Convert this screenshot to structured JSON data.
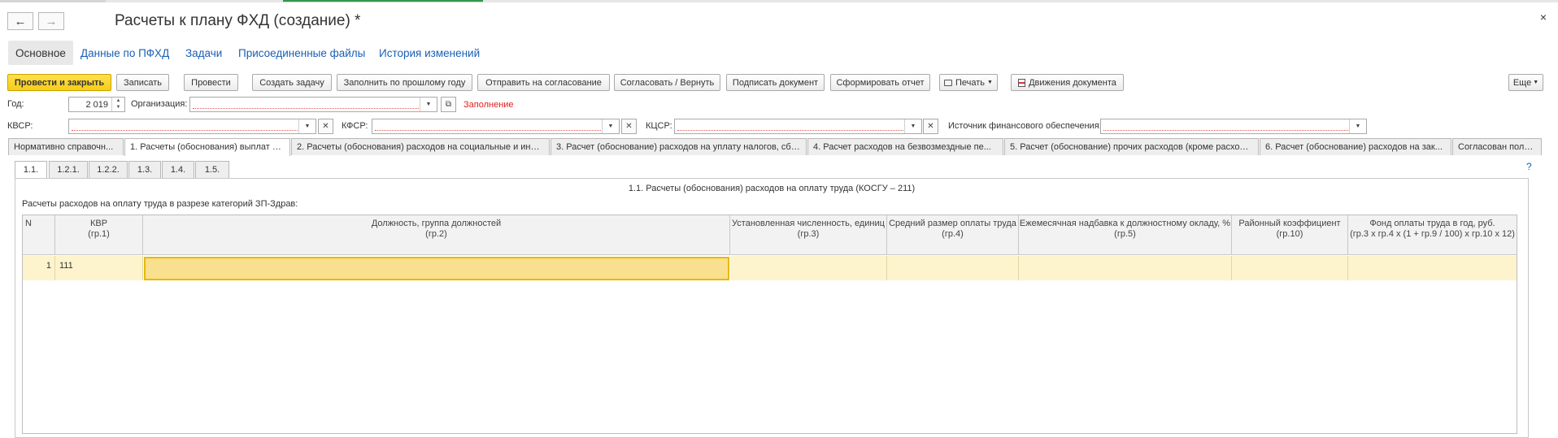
{
  "window": {
    "title": "Расчеты к плану ФХД (создание) *",
    "back_icon": "←",
    "forward_icon": "→",
    "close_icon": "×"
  },
  "nav_tabs": [
    "Основное",
    "Данные по ПФХД",
    "Задачи",
    "Присоединенные файлы",
    "История изменений"
  ],
  "toolbar": {
    "post_close": "Провести и закрыть",
    "save": "Записать",
    "post": "Провести",
    "create_task": "Создать задачу",
    "fill_last_year": "Заполнить по прошлому году",
    "send_approval": "Отправить на согласование",
    "approve_return": "Согласовать / Вернуть",
    "sign": "Подписать документ",
    "report": "Сформировать отчет",
    "print": "Печать",
    "movements": "Движения документа",
    "more": "Еще"
  },
  "form": {
    "year_label": "Год:",
    "year_value": "2 019",
    "org_label": "Организация:",
    "org_value": "",
    "status_text": "Заполнение",
    "kvsr_label": "КВСР:",
    "kfsr_label": "КФСР:",
    "kcsr_label": "КЦСР:",
    "source_label": "Источник финансового обеспечения:"
  },
  "page_tabs": [
    "Нормативно справочн...",
    "1. Расчеты (обоснования) выплат п...",
    "2. Расчеты (обоснования) расходов на социальные и ины...",
    "3. Расчет (обоснование) расходов на уплату налогов, сбо...",
    "4. Расчет расходов на безвозмездные пе...",
    "5. Расчет (обоснование) прочих расходов (кроме расходо...",
    "6. Расчет (обоснование) расходов на зак...",
    "Согласован поль..."
  ],
  "sub_tabs": [
    "1.1.",
    "1.2.1.",
    "1.2.2.",
    "1.3.",
    "1.4.",
    "1.5."
  ],
  "help_icon": "?",
  "section": {
    "title": "1.1. Расчеты (обоснования) расходов на оплату труда (КОСГУ – 211)",
    "caption": "Расчеты расходов на оплату труда в разрезе категорий ЗП-Здрав:"
  },
  "table": {
    "headers": [
      {
        "l1": "N",
        "l2": ""
      },
      {
        "l1": "КВР",
        "l2": "(гр.1)"
      },
      {
        "l1": "Должность, группа должностей",
        "l2": "(гр.2)"
      },
      {
        "l1": "Установленная численность, единиц",
        "l2": "(гр.3)"
      },
      {
        "l1": "Средний размер оплаты труда",
        "l2": "(гр.4)"
      },
      {
        "l1": "Ежемесячная надбавка к должностному окладу, %",
        "l2": "(гр.5)"
      },
      {
        "l1": "Районный коэффициент",
        "l2": "(гр.10)"
      },
      {
        "l1": "Фонд оплаты труда в год, руб.",
        "l2": "(гр.3 х гр.4 х (1 + гр.9 / 100) х гр.10 х 12)"
      }
    ],
    "rows": [
      {
        "n": "1",
        "kvr": "111",
        "position": "",
        "count": "",
        "avg_pay": "",
        "bonus": "",
        "coef": "",
        "fund": ""
      }
    ]
  },
  "colors": {
    "primary_button": "#f7cc18",
    "link": "#1a5fb4",
    "status": "#e02020",
    "selected_row": "#fdf3cc",
    "active_cell": "#f8e08e"
  }
}
